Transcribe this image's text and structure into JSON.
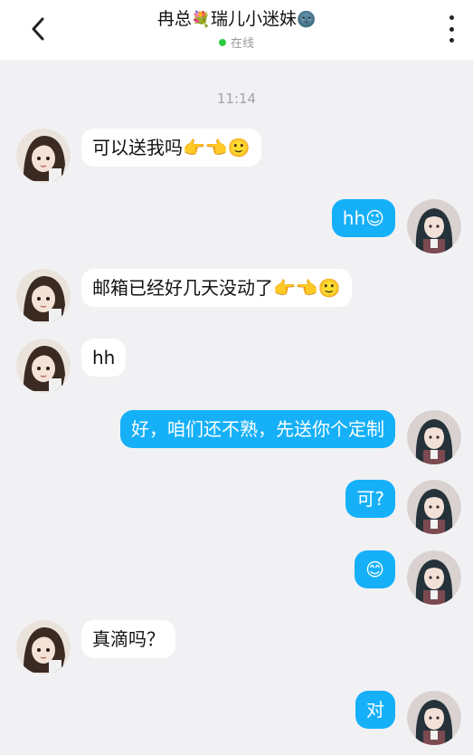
{
  "header": {
    "title_prefix": "冉总",
    "title_flower": "💐",
    "title_name": "瑞儿小迷妹",
    "title_face": "🌚",
    "status": "在线",
    "back_icon": "chevron-left-icon",
    "more_icon": "more-vertical-icon"
  },
  "chat": {
    "timestamp": "11:14",
    "messages": [
      {
        "side": "left",
        "text": "可以送我吗👉👈🙂"
      },
      {
        "side": "right",
        "text": "hh😉"
      },
      {
        "side": "left",
        "text": "邮箱已经好几天没动了👉👈🙂"
      },
      {
        "side": "left",
        "text": "hh"
      },
      {
        "side": "right",
        "text": "好，咱们还不熟，先送你个定制"
      },
      {
        "side": "right",
        "text": "可?"
      },
      {
        "side": "right",
        "text": "😊"
      },
      {
        "side": "left",
        "text": "真滴吗？"
      },
      {
        "side": "right",
        "text": "对"
      }
    ]
  },
  "colors": {
    "outgoing_bubble": "#15b0f8",
    "incoming_bubble": "#ffffff",
    "background": "#f1f1f4",
    "online_dot": "#2ecc40"
  }
}
